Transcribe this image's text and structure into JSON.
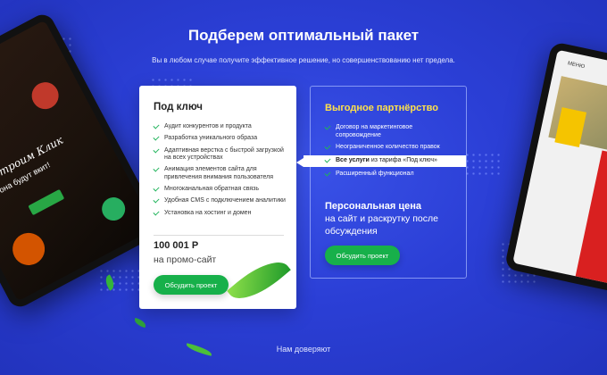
{
  "header": {
    "title": "Подберем оптимальный пакет",
    "subtitle": "Вы в любом случае получите эффективное решение, но совершенствованию нет предела."
  },
  "card_basic": {
    "title": "Под ключ",
    "features": [
      "Аудит конкурентов и продукта",
      "Разработка уникального образа",
      "Адаптивная верстка с быстрой загрузкой на всех устройствах",
      "Анимация элементов сайта для привлечения внимания пользователя",
      "Многоканальная обратная связь",
      "Удобная CMS с подключением аналитики",
      "Установка на хостинг и домен"
    ],
    "price": "100 001 Р",
    "price_note": "на промо-сайт",
    "button": "Обсудить проект"
  },
  "card_partner": {
    "title": "Выгодное партнёрство",
    "features": [
      "Договор на маркетинговое сопровождение",
      "Неограниченное количество правок"
    ],
    "highlight_bold": "Все услуги",
    "highlight_rest": " из тарифа «Под ключ»",
    "feature_last": "Расширенный функционал",
    "special_title": "Персональная цена",
    "special_text": "на сайт и раскрутку после обсуждения",
    "button": "Обсудить проект"
  },
  "left_tablet": {
    "script_title": "Строим Клик",
    "tagline": "она будут вкит!"
  },
  "right_tablet": {
    "menu": "МЕНЮ"
  },
  "footer": {
    "trust": "Нам доверяют"
  },
  "colors": {
    "background": "#2b3fd6",
    "accent_green": "#17b04a",
    "partner_title": "#ffe14a"
  }
}
